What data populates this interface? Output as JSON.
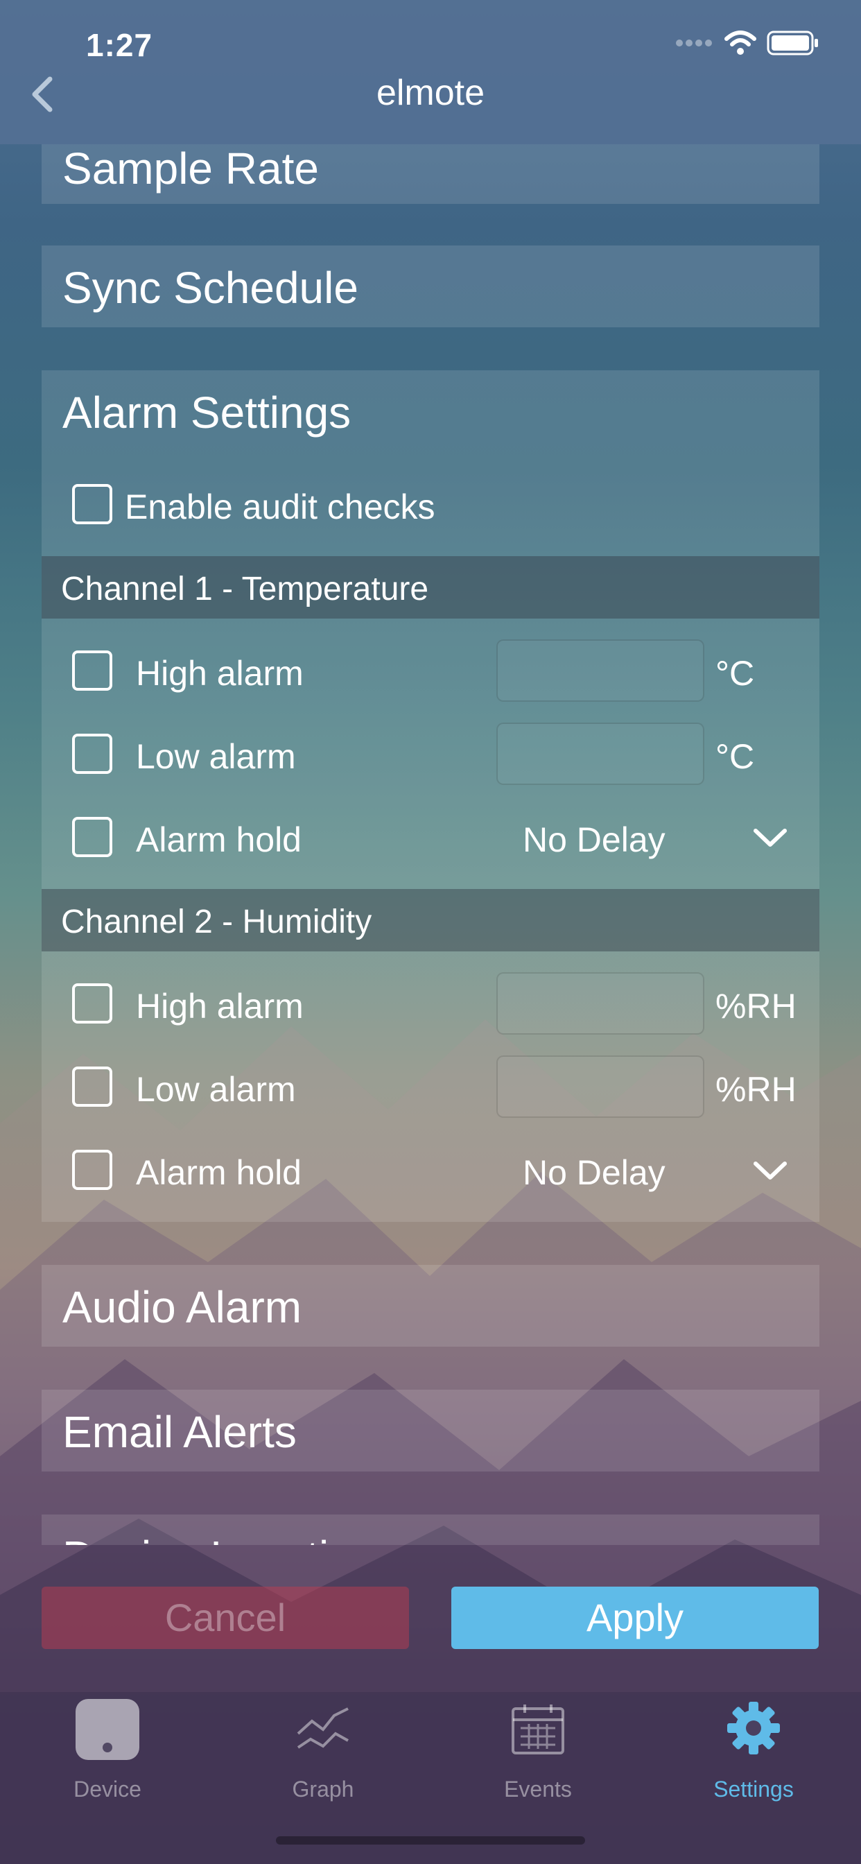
{
  "status": {
    "time": "1:27"
  },
  "nav": {
    "title": "elmote"
  },
  "sections": {
    "sample_rate": "Sample Rate",
    "sync_schedule": "Sync Schedule",
    "alarm_settings": "Alarm Settings",
    "audio_alarm": "Audio Alarm",
    "email_alerts": "Email Alerts",
    "device_location": "Device Location"
  },
  "alarm": {
    "audit_label": "Enable audit checks",
    "channel1": {
      "header": "Channel 1 - Temperature",
      "high_label": "High alarm",
      "high_value": "",
      "high_unit": "°C",
      "low_label": "Low alarm",
      "low_value": "",
      "low_unit": "°C",
      "hold_label": "Alarm hold",
      "hold_value": "No Delay"
    },
    "channel2": {
      "header": "Channel 2 - Humidity",
      "high_label": "High alarm",
      "high_value": "",
      "high_unit": "%RH",
      "low_label": "Low alarm",
      "low_value": "",
      "low_unit": "%RH",
      "hold_label": "Alarm hold",
      "hold_value": "No Delay"
    }
  },
  "actions": {
    "cancel": "Cancel",
    "apply": "Apply"
  },
  "tabs": [
    {
      "label": "Device",
      "icon": "device-icon"
    },
    {
      "label": "Graph",
      "icon": "graph-icon"
    },
    {
      "label": "Events",
      "icon": "calendar-icon"
    },
    {
      "label": "Settings",
      "icon": "gear-icon",
      "active": true
    }
  ],
  "colors": {
    "accent": "#5fbbe8",
    "cancel": "#c83c50"
  }
}
